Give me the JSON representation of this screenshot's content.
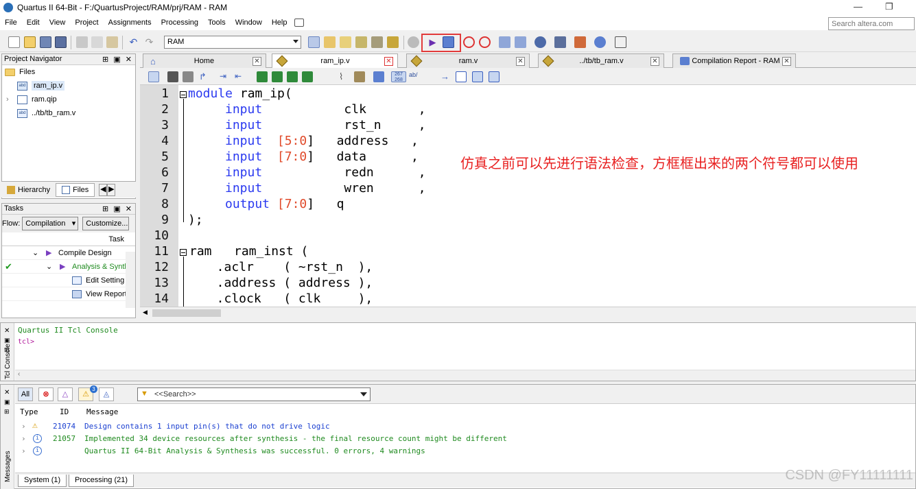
{
  "window": {
    "title": "Quartus II 64-Bit - F:/QuartusProject/RAM/prj/RAM - RAM",
    "minimize": "—",
    "restore": "❐"
  },
  "menu": [
    "File",
    "Edit",
    "View",
    "Project",
    "Assignments",
    "Processing",
    "Tools",
    "Window",
    "Help"
  ],
  "search": {
    "placeholder": "Search altera.com"
  },
  "toolbar": {
    "revision": "RAM"
  },
  "navigator": {
    "title": "Project Navigator",
    "controls": "⊞ ▣ ✕",
    "root": "Files",
    "files": [
      "ram_ip.v",
      "ram.qip",
      "../tb/tb_ram.v"
    ],
    "tabs": [
      "Hierarchy",
      "Files"
    ]
  },
  "tasks": {
    "title": "Tasks",
    "controls": "⊞ ▣ ✕",
    "flow_label": "Flow:",
    "flow_value": "Compilation",
    "customize": "Customize...",
    "col_task": "Task",
    "items": [
      "Compile Design",
      "Analysis & Synth",
      "Edit Setting",
      "View Report"
    ]
  },
  "editor_tabs": [
    {
      "label": "Home"
    },
    {
      "label": "ram_ip.v"
    },
    {
      "label": "ram.v"
    },
    {
      "label": "../tb/tb_ram.v"
    },
    {
      "label": "Compilation Report - RAM"
    }
  ],
  "editor_toolbar_labels": {
    "line_numbers": "267 268",
    "abc": "ab/"
  },
  "code": {
    "line_numbers": [
      "1",
      "2",
      "3",
      "4",
      "5",
      "6",
      "7",
      "8",
      "9",
      "10",
      "11",
      "12",
      "13",
      "14"
    ],
    "l1_kw": "module",
    "l1_rest": " ram_ip(",
    "l2_kw": "input",
    "l2_rest": "           clk       ,",
    "l3_kw": "input",
    "l3_rest": "           rst_n     ,",
    "l4_kw": "input",
    "l4_a": "  [",
    "l4_n1": "5",
    "l4_b": ":",
    "l4_n2": "0",
    "l4_c": "]   address   ,",
    "l5_kw": "input",
    "l5_a": "  [",
    "l5_n1": "7",
    "l5_b": ":",
    "l5_n2": "0",
    "l5_c": "]   data      ,",
    "l6_kw": "input",
    "l6_rest": "           redn      ,",
    "l7_kw": "input",
    "l7_rest": "           wren      ,",
    "l8_kw": "output",
    "l8_a": " [",
    "l8_n1": "7",
    "l8_b": ":",
    "l8_n2": "0",
    "l8_c": "]   q",
    "l9": ");",
    "l10": "",
    "l11": "ram   ram_inst (",
    "l12": "  .aclr    ( ~rst_n  ),",
    "l13": "  .address ( address ),",
    "l14": "  .clock   ( clk     ),"
  },
  "annotation": "仿真之前可以先进行语法检查，方框框出来的两个符号都可以使用",
  "tcl": {
    "side_label": "Tcl Console",
    "header": "Quartus II Tcl Console",
    "prompt": "tcl>"
  },
  "messages": {
    "side_label": "Messages",
    "filter_all": "All",
    "badge_count": "3",
    "search_placeholder": "<<Search>>",
    "columns": [
      "Type",
      "ID",
      "Message"
    ],
    "rows": [
      {
        "id": "21074",
        "text": "Design contains 1 input pin(s) that do not drive logic",
        "color": "#1a3fd0"
      },
      {
        "id": "21057",
        "text": "Implemented 34 device resources after synthesis - the final resource count might be different",
        "color": "#1f8a1f"
      },
      {
        "id": "",
        "text": "Quartus II 64-Bit Analysis & Synthesis was successful. 0 errors, 4 warnings",
        "color": "#1f8a1f"
      }
    ],
    "tabs": [
      "System (1)",
      "Processing (21)"
    ]
  },
  "watermark": "CSDN @FY11111111",
  "colors": {
    "keyword": "#2b3af0",
    "number": "#e04a2a",
    "annotation": "#e82020",
    "highlight": "#e23b3b"
  }
}
